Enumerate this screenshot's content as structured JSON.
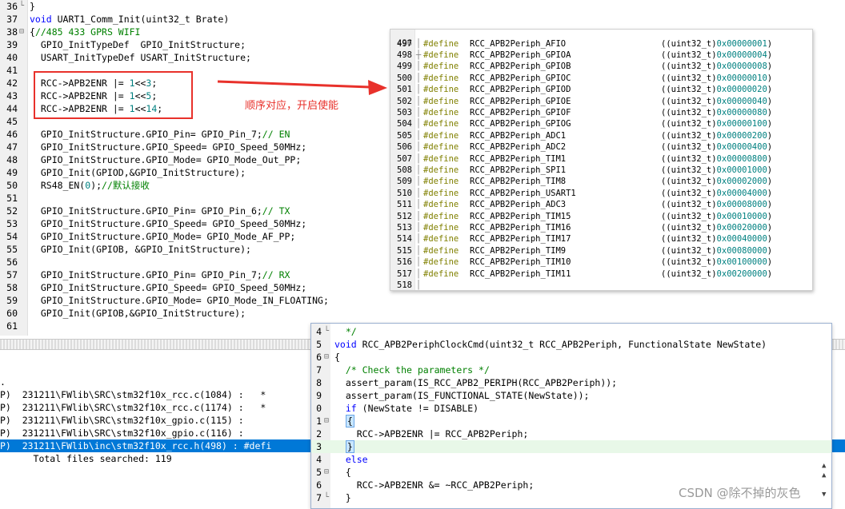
{
  "main_editor": {
    "lines": [
      {
        "n": "36",
        "fold": "└",
        "parts": [
          {
            "t": "}",
            "c": ""
          }
        ]
      },
      {
        "n": "37",
        "fold": "",
        "parts": [
          {
            "t": "void",
            "c": "kw"
          },
          {
            "t": " UART1_Comm_Init(uint32_t Brate)",
            "c": ""
          }
        ]
      },
      {
        "n": "38",
        "fold": "⊟",
        "parts": [
          {
            "t": "{",
            "c": ""
          },
          {
            "t": "//485 433 GPRS WIFI",
            "c": "cm"
          }
        ]
      },
      {
        "n": "39",
        "fold": "",
        "parts": [
          {
            "t": "  GPIO_InitTypeDef  GPIO_InitStructure;",
            "c": ""
          }
        ]
      },
      {
        "n": "40",
        "fold": "",
        "parts": [
          {
            "t": "  USART_InitTypeDef USART_InitStructure;",
            "c": ""
          }
        ]
      },
      {
        "n": "41",
        "fold": "",
        "parts": [
          {
            "t": "",
            "c": ""
          }
        ]
      },
      {
        "n": "42",
        "fold": "",
        "parts": [
          {
            "t": "  RCC->APB2ENR |= ",
            "c": ""
          },
          {
            "t": "1",
            "c": "num"
          },
          {
            "t": "<<",
            "c": ""
          },
          {
            "t": "3",
            "c": "num"
          },
          {
            "t": ";",
            "c": ""
          }
        ]
      },
      {
        "n": "43",
        "fold": "",
        "parts": [
          {
            "t": "  RCC->APB2ENR |= ",
            "c": ""
          },
          {
            "t": "1",
            "c": "num"
          },
          {
            "t": "<<",
            "c": ""
          },
          {
            "t": "5",
            "c": "num"
          },
          {
            "t": ";",
            "c": ""
          }
        ]
      },
      {
        "n": "44",
        "fold": "",
        "parts": [
          {
            "t": "  RCC->APB2ENR |= ",
            "c": ""
          },
          {
            "t": "1",
            "c": "num"
          },
          {
            "t": "<<",
            "c": ""
          },
          {
            "t": "14",
            "c": "num"
          },
          {
            "t": ";",
            "c": ""
          }
        ]
      },
      {
        "n": "45",
        "fold": "",
        "parts": [
          {
            "t": "",
            "c": ""
          }
        ]
      },
      {
        "n": "46",
        "fold": "",
        "parts": [
          {
            "t": "  GPIO_InitStructure.GPIO_Pin= GPIO_Pin_7;",
            "c": ""
          },
          {
            "t": "// EN",
            "c": "cm"
          }
        ]
      },
      {
        "n": "47",
        "fold": "",
        "parts": [
          {
            "t": "  GPIO_InitStructure.GPIO_Speed= GPIO_Speed_50MHz;",
            "c": ""
          }
        ]
      },
      {
        "n": "48",
        "fold": "",
        "parts": [
          {
            "t": "  GPIO_InitStructure.GPIO_Mode= GPIO_Mode_Out_PP;",
            "c": ""
          }
        ]
      },
      {
        "n": "49",
        "fold": "",
        "parts": [
          {
            "t": "  GPIO_Init(GPIOD,&GPIO_InitStructure);",
            "c": ""
          }
        ]
      },
      {
        "n": "50",
        "fold": "",
        "parts": [
          {
            "t": "  RS48_EN(",
            "c": ""
          },
          {
            "t": "0",
            "c": "num"
          },
          {
            "t": ");",
            "c": ""
          },
          {
            "t": "//默认接收",
            "c": "cm"
          }
        ]
      },
      {
        "n": "51",
        "fold": "",
        "parts": [
          {
            "t": "",
            "c": ""
          }
        ]
      },
      {
        "n": "52",
        "fold": "",
        "parts": [
          {
            "t": "  GPIO_InitStructure.GPIO_Pin= GPIO_Pin_6;",
            "c": ""
          },
          {
            "t": "// TX",
            "c": "cm"
          }
        ]
      },
      {
        "n": "53",
        "fold": "",
        "parts": [
          {
            "t": "  GPIO_InitStructure.GPIO_Speed= GPIO_Speed_50MHz;",
            "c": ""
          }
        ]
      },
      {
        "n": "54",
        "fold": "",
        "parts": [
          {
            "t": "  GPIO_InitStructure.GPIO_Mode= GPIO_Mode_AF_PP;",
            "c": ""
          }
        ]
      },
      {
        "n": "55",
        "fold": "",
        "parts": [
          {
            "t": "  GPIO_Init(GPIOB, &GPIO_InitStructure);",
            "c": ""
          }
        ]
      },
      {
        "n": "56",
        "fold": "",
        "parts": [
          {
            "t": "",
            "c": ""
          }
        ]
      },
      {
        "n": "57",
        "fold": "",
        "parts": [
          {
            "t": "  GPIO_InitStructure.GPIO_Pin= GPIO_Pin_7;",
            "c": ""
          },
          {
            "t": "// RX",
            "c": "cm"
          }
        ]
      },
      {
        "n": "58",
        "fold": "",
        "parts": [
          {
            "t": "  GPIO_InitStructure.GPIO_Speed= GPIO_Speed_50MHz;",
            "c": ""
          }
        ]
      },
      {
        "n": "59",
        "fold": "",
        "parts": [
          {
            "t": "  GPIO_InitStructure.GPIO_Mode= GPIO_Mode_IN_FLOATING;",
            "c": ""
          }
        ]
      },
      {
        "n": "60",
        "fold": "",
        "parts": [
          {
            "t": "  GPIO_Init(GPIOB,&GPIO_InitStructure);",
            "c": ""
          }
        ]
      },
      {
        "n": "61",
        "fold": "",
        "parts": [
          {
            "t": "",
            "c": ""
          }
        ]
      }
    ]
  },
  "annotation": {
    "text": "顺序对应，开启使能",
    "color": "#e8312b"
  },
  "header_popup": {
    "top_partial_line": "496",
    "lines": [
      {
        "n": "497",
        "kw": "#define",
        "name": "RCC_APB2Periph_AFIO",
        "cast": "((uint32_t)",
        "hex": "0x00000001",
        "end": ")"
      },
      {
        "n": "498",
        "kw": "#define",
        "name": "RCC_APB2Periph_GPIOA",
        "cast": "((uint32_t)",
        "hex": "0x00000004",
        "end": ")"
      },
      {
        "n": "499",
        "kw": "#define",
        "name": "RCC_APB2Periph_GPIOB",
        "cast": "((uint32_t)",
        "hex": "0x00000008",
        "end": ")"
      },
      {
        "n": "500",
        "kw": "#define",
        "name": "RCC_APB2Periph_GPIOC",
        "cast": "((uint32_t)",
        "hex": "0x00000010",
        "end": ")"
      },
      {
        "n": "501",
        "kw": "#define",
        "name": "RCC_APB2Periph_GPIOD",
        "cast": "((uint32_t)",
        "hex": "0x00000020",
        "end": ")"
      },
      {
        "n": "502",
        "kw": "#define",
        "name": "RCC_APB2Periph_GPIOE",
        "cast": "((uint32_t)",
        "hex": "0x00000040",
        "end": ")"
      },
      {
        "n": "503",
        "kw": "#define",
        "name": "RCC_APB2Periph_GPIOF",
        "cast": "((uint32_t)",
        "hex": "0x00000080",
        "end": ")"
      },
      {
        "n": "504",
        "kw": "#define",
        "name": "RCC_APB2Periph_GPIOG",
        "cast": "((uint32_t)",
        "hex": "0x00000100",
        "end": ")"
      },
      {
        "n": "505",
        "kw": "#define",
        "name": "RCC_APB2Periph_ADC1",
        "cast": "((uint32_t)",
        "hex": "0x00000200",
        "end": ")"
      },
      {
        "n": "506",
        "kw": "#define",
        "name": "RCC_APB2Periph_ADC2",
        "cast": "((uint32_t)",
        "hex": "0x00000400",
        "end": ")"
      },
      {
        "n": "507",
        "kw": "#define",
        "name": "RCC_APB2Periph_TIM1",
        "cast": "((uint32_t)",
        "hex": "0x00000800",
        "end": ")"
      },
      {
        "n": "508",
        "kw": "#define",
        "name": "RCC_APB2Periph_SPI1",
        "cast": "((uint32_t)",
        "hex": "0x00001000",
        "end": ")"
      },
      {
        "n": "509",
        "kw": "#define",
        "name": "RCC_APB2Periph_TIM8",
        "cast": "((uint32_t)",
        "hex": "0x00002000",
        "end": ")"
      },
      {
        "n": "510",
        "kw": "#define",
        "name": "RCC_APB2Periph_USART1",
        "cast": "((uint32_t)",
        "hex": "0x00004000",
        "end": ")"
      },
      {
        "n": "511",
        "kw": "#define",
        "name": "RCC_APB2Periph_ADC3",
        "cast": "((uint32_t)",
        "hex": "0x00008000",
        "end": ")"
      },
      {
        "n": "512",
        "kw": "#define",
        "name": "RCC_APB2Periph_TIM15",
        "cast": "((uint32_t)",
        "hex": "0x00010000",
        "end": ")"
      },
      {
        "n": "513",
        "kw": "#define",
        "name": "RCC_APB2Periph_TIM16",
        "cast": "((uint32_t)",
        "hex": "0x00020000",
        "end": ")"
      },
      {
        "n": "514",
        "kw": "#define",
        "name": "RCC_APB2Periph_TIM17",
        "cast": "((uint32_t)",
        "hex": "0x00040000",
        "end": ")"
      },
      {
        "n": "515",
        "kw": "#define",
        "name": "RCC_APB2Periph_TIM9",
        "cast": "((uint32_t)",
        "hex": "0x00080000",
        "end": ")"
      },
      {
        "n": "516",
        "kw": "#define",
        "name": "RCC_APB2Periph_TIM10",
        "cast": "((uint32_t)",
        "hex": "0x00100000",
        "end": ")"
      },
      {
        "n": "517",
        "kw": "#define",
        "name": "RCC_APB2Periph_TIM11",
        "cast": "((uint32_t)",
        "hex": "0x00200000",
        "end": ")"
      },
      {
        "n": "518",
        "kw": "",
        "name": "",
        "cast": "",
        "hex": "",
        "end": ""
      }
    ]
  },
  "search_results": {
    "lines": [
      {
        "text": ".",
        "selected": false
      },
      {
        "text": "P)  231211\\FWlib\\SRC\\stm32f10x_rcc.c(1084) :   *",
        "selected": false
      },
      {
        "text": "P)  231211\\FWlib\\SRC\\stm32f10x_rcc.c(1174) :   *",
        "selected": false
      },
      {
        "text": "P)  231211\\FWlib\\SRC\\stm32f10x_gpio.c(115) :",
        "selected": false
      },
      {
        "text": "P)  231211\\FWlib\\SRC\\stm32f10x_gpio.c(116) :",
        "selected": false
      },
      {
        "text": "P)  231211\\FWlib\\inc\\stm32f10x_rcc.h(498) : #defi",
        "selected": true
      },
      {
        "text": "      Total files searched: 119",
        "selected": false
      }
    ]
  },
  "func_popup": {
    "lines": [
      {
        "n": "4",
        "fold": "└",
        "parts": [
          {
            "t": "  */",
            "c": "cm"
          }
        ],
        "current": false
      },
      {
        "n": "5",
        "fold": "",
        "parts": [
          {
            "t": "void",
            "c": "kw"
          },
          {
            "t": " RCC_APB2PeriphClockCmd(uint32_t RCC_APB2Periph, FunctionalState NewState)",
            "c": ""
          }
        ],
        "current": false
      },
      {
        "n": "6",
        "fold": "⊟",
        "parts": [
          {
            "t": "{",
            "c": ""
          }
        ],
        "current": false
      },
      {
        "n": "7",
        "fold": "",
        "parts": [
          {
            "t": "  ",
            "c": ""
          },
          {
            "t": "/* Check the parameters */",
            "c": "cm"
          }
        ],
        "current": false
      },
      {
        "n": "8",
        "fold": "",
        "parts": [
          {
            "t": "  assert_param(IS_RCC_APB2_PERIPH(RCC_APB2Periph));",
            "c": ""
          }
        ],
        "current": false
      },
      {
        "n": "9",
        "fold": "",
        "parts": [
          {
            "t": "  assert_param(IS_FUNCTIONAL_STATE(NewState));",
            "c": ""
          }
        ],
        "current": false
      },
      {
        "n": "0",
        "fold": "",
        "parts": [
          {
            "t": "  ",
            "c": ""
          },
          {
            "t": "if",
            "c": "kw"
          },
          {
            "t": " (NewState != DISABLE)",
            "c": ""
          }
        ],
        "current": false
      },
      {
        "n": "1",
        "fold": "⊟",
        "parts": [
          {
            "t": "  ",
            "c": ""
          },
          {
            "t": "{",
            "c": "brace"
          }
        ],
        "current": false
      },
      {
        "n": "2",
        "fold": "",
        "parts": [
          {
            "t": "    RCC->APB2ENR |= RCC_APB2Periph;",
            "c": ""
          }
        ],
        "current": false
      },
      {
        "n": "3",
        "fold": "",
        "parts": [
          {
            "t": "  ",
            "c": ""
          },
          {
            "t": "}",
            "c": "brace"
          }
        ],
        "current": true
      },
      {
        "n": "4",
        "fold": "",
        "parts": [
          {
            "t": "  ",
            "c": ""
          },
          {
            "t": "else",
            "c": "kw"
          }
        ],
        "current": false
      },
      {
        "n": "5",
        "fold": "⊟",
        "parts": [
          {
            "t": "  {",
            "c": ""
          }
        ],
        "current": false
      },
      {
        "n": "6",
        "fold": "",
        "parts": [
          {
            "t": "    RCC->APB2ENR &= ~RCC_APB2Periph;",
            "c": ""
          }
        ],
        "current": false
      },
      {
        "n": "7",
        "fold": "└",
        "parts": [
          {
            "t": "  }",
            "c": ""
          }
        ],
        "current": false
      }
    ]
  },
  "watermark": "CSDN @除不掉的灰色",
  "colors": {
    "keyword": "#0000ff",
    "comment": "#008000",
    "number": "#008080",
    "define": "#808000",
    "selection": "#0078d7",
    "accent": "#e8312b"
  }
}
